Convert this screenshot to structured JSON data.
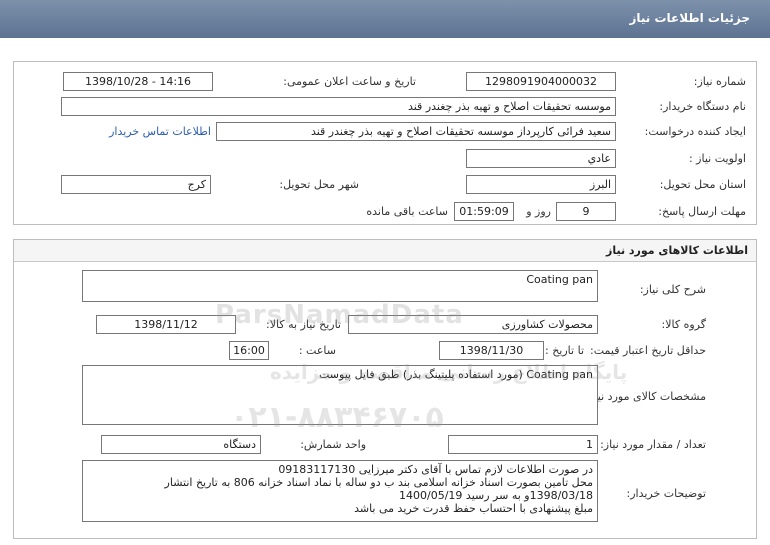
{
  "page": {
    "title": "جزئیات اطلاعات نیاز"
  },
  "section1": {
    "need_number_label": "شماره نیاز:",
    "need_number": "1298091904000032",
    "announce_label": "تاریخ و ساعت اعلان عمومی:",
    "announce_value": "1398/10/28 - 14:16",
    "buyer_label": "نام دستگاه خریدار:",
    "buyer_value": "موسسه تحقیقات اصلاح و تهیه بذر چغندر قند",
    "creator_label": "ایجاد کننده درخواست:",
    "creator_value": "سعید فرائی کارپرداز موسسه تحقیقات اصلاح و تهیه بذر چغندر قند",
    "contact_link": "اطلاعات تماس خریدار",
    "priority_label": "اولویت نیاز :",
    "priority_value": "عادي",
    "province_label": "استان محل تحویل:",
    "province_value": "البرز",
    "city_label": "شهر محل تحویل:",
    "city_value": "کرج",
    "deadline_label": "مهلت ارسال پاسخ:",
    "days_value": "9",
    "days_label": "روز و",
    "time_value": "01:59:09",
    "remaining_label": "ساعت باقی مانده"
  },
  "section2": {
    "header": "اطلاعات کالاهای مورد نیاز",
    "general_desc_label": "شرح کلی نیاز:",
    "general_desc_value": "Coating pan",
    "group_label": "گروه کالا:",
    "group_value": "محصولات کشاورزی",
    "need_date_label": "تاریخ نیاز به کالا:",
    "need_date_value": "1398/11/12",
    "min_price_label": "حداقل تاریخ اعتبار قیمت:",
    "until_date_label": "تا تاریخ :",
    "until_date_value": "1398/11/30",
    "hour_label": "ساعت :",
    "hour_value": "16:00",
    "spec_label": "مشخصات کالای مورد نیاز:",
    "spec_value": "Coating pan (مورد استفاده پلیتینگ بذر) طبق فایل پیوست",
    "qty_label": "تعداد / مقدار مورد نیاز:",
    "qty_value": "1",
    "unit_label": "واحد شمارش:",
    "unit_value": "دستگاه",
    "buyer_notes_label": "توضیحات خریدار:",
    "buyer_notes_lines": [
      "در صورت اطلاعات لازم تماس با آقای دکتر میرزایی       09183117130",
      "محل تامین بصورت اسناد خزانه اسلامی بند ب دو ساله با نماد اسناد خزانه 806 به تاریخ انتشار",
      "1398/03/18و به سر رسید 1400/05/19",
      "مبلغ پیشنهادی با احتساب حفظ قدرت خرید می باشد"
    ]
  },
  "watermark": {
    "brand": "ParsNamadData",
    "line2": "پایگاه اطلاع رسانی مناقصه و مزایده",
    "line3": "۰۲۱-۸۸۳۴۶۷۰۵"
  }
}
